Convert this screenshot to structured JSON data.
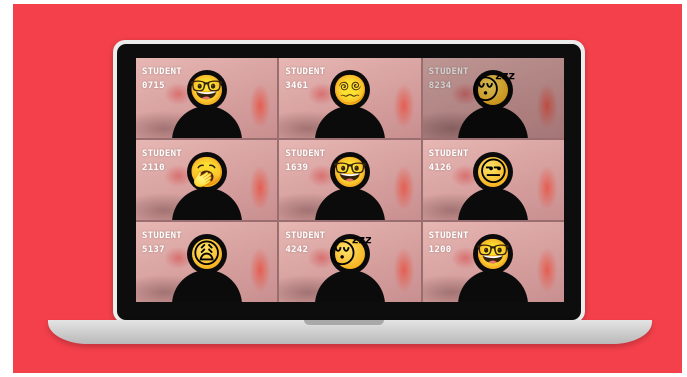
{
  "tiles": [
    {
      "label": "STUDENT",
      "id": "0715",
      "emoji": "🤓",
      "icon": "nerd-face-icon"
    },
    {
      "label": "STUDENT",
      "id": "3461",
      "emoji": "😵‍💫",
      "icon": "dizzy-face-icon"
    },
    {
      "label": "STUDENT",
      "id": "8234",
      "emoji": "😴",
      "icon": "sleeping-face-icon"
    },
    {
      "label": "STUDENT",
      "id": "2110",
      "emoji": "🥱",
      "icon": "yawning-face-icon"
    },
    {
      "label": "STUDENT",
      "id": "1639",
      "emoji": "🤓",
      "icon": "nerd-face-icon"
    },
    {
      "label": "STUDENT",
      "id": "4126",
      "emoji": "😒",
      "icon": "unamused-face-icon"
    },
    {
      "label": "STUDENT",
      "id": "5137",
      "emoji": "😩",
      "icon": "weary-face-icon"
    },
    {
      "label": "STUDENT",
      "id": "4242",
      "emoji": "😴",
      "icon": "sleeping-face-icon"
    },
    {
      "label": "STUDENT",
      "id": "1200",
      "emoji": "🤓",
      "icon": "nerd-face-icon"
    }
  ],
  "colors": {
    "background": "#f4404b",
    "bezel": "#0d0d0d",
    "laptop_body": "#ececec"
  }
}
